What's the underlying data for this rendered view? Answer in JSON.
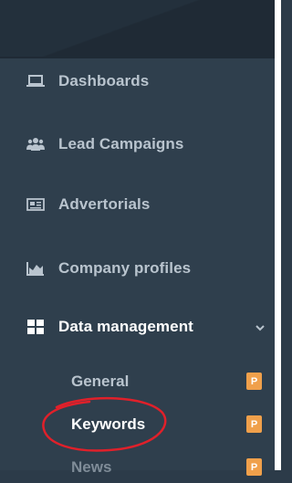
{
  "sidebar": {
    "items": [
      {
        "label": "Dashboards",
        "icon": "laptop-icon"
      },
      {
        "label": "Lead Campaigns",
        "icon": "users-icon"
      },
      {
        "label": "Advertorials",
        "icon": "newspaper-icon"
      },
      {
        "label": "Company profiles",
        "icon": "area-chart-icon"
      },
      {
        "label": "Data management",
        "icon": "grid-icon",
        "expanded": true
      }
    ],
    "submenu": [
      {
        "label": "General",
        "badge": "P"
      },
      {
        "label": "Keywords",
        "badge": "P",
        "current": true
      },
      {
        "label": "News",
        "badge": "P"
      }
    ]
  },
  "colors": {
    "sidebar_bg": "#2f3f4d",
    "top_bg": "#23303c",
    "text": "#b9c4ce",
    "text_active": "#ffffff",
    "badge": "#f0a04b",
    "annotation_circle": "#e0202a"
  }
}
